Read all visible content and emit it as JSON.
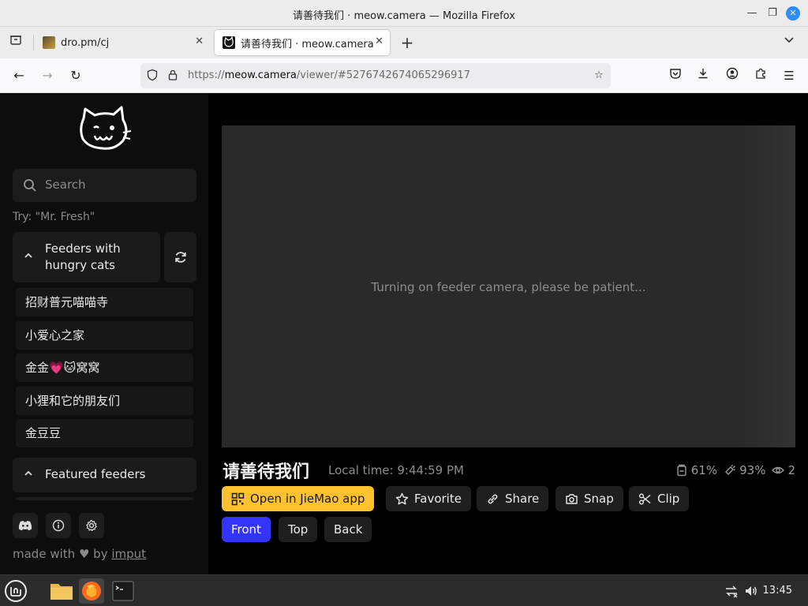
{
  "window": {
    "title": "请善待我们 · meow.camera — Mozilla Firefox"
  },
  "tabs": [
    {
      "label": "dro.pm/cj",
      "active": false
    },
    {
      "label": "请善待我们 · meow.camera",
      "active": true
    }
  ],
  "urlbar": {
    "protocol": "https://",
    "host": "meow.camera",
    "path": "/viewer/#5276742674065296917"
  },
  "sidebar": {
    "search_placeholder": "Search",
    "hint": "Try: \"Mr. Fresh\"",
    "hungry_section": {
      "line1": "Feeders with",
      "line2": "hungry cats"
    },
    "feeders": [
      "招财普元喵喵寺",
      "小爱心之家",
      "金金💗🐱窝窝",
      "小狸和它的朋友们",
      "金豆豆"
    ],
    "featured_section": "Featured feeders",
    "footer": {
      "made_with": "made with",
      "by": "by",
      "author": "imput"
    }
  },
  "viewer": {
    "status": "Turning on feeder camera, please be patient..."
  },
  "feeder": {
    "name": "请善待我们",
    "local_time": "Local time: 9:44:59 PM",
    "food": "61%",
    "battery": "93%",
    "viewers": "2"
  },
  "actions": {
    "open_app": "Open in JieMao app",
    "favorite": "Favorite",
    "share": "Share",
    "snap": "Snap",
    "clip": "Clip"
  },
  "cameras": {
    "front": "Front",
    "top": "Top",
    "back": "Back",
    "selected": "Front"
  },
  "taskbar": {
    "clock": "13:45"
  },
  "colors": {
    "accent_yellow": "#ffc12e",
    "accent_blue": "#3434ff",
    "page_bg": "#000000",
    "sidebar_bg": "#0d0d0d"
  }
}
